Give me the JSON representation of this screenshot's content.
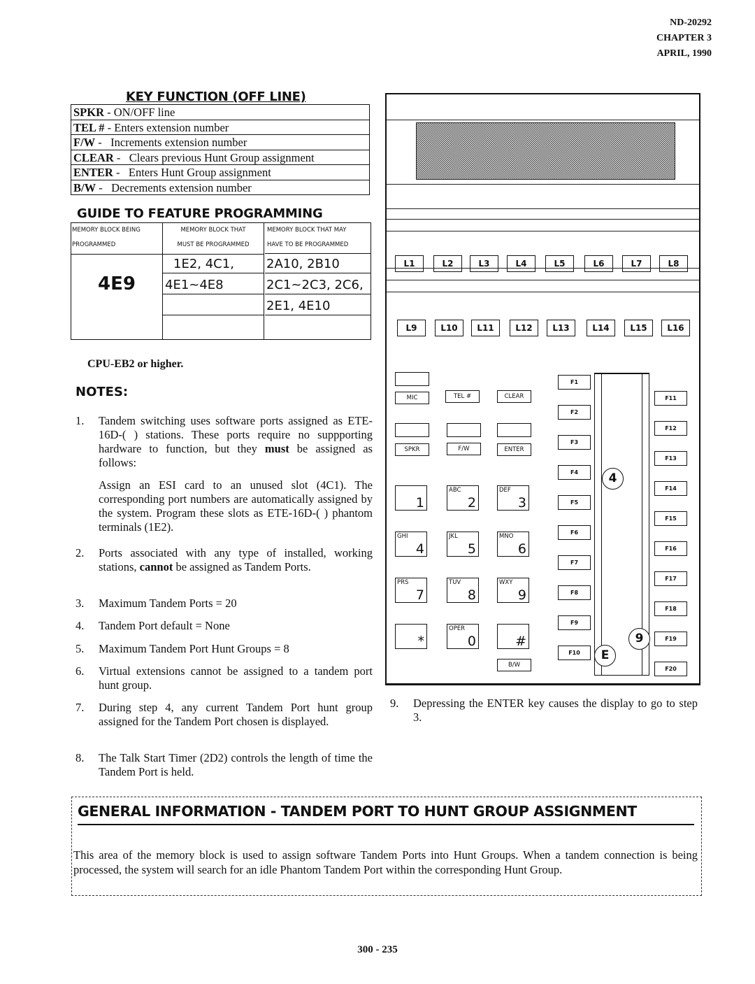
{
  "header": {
    "doc_id": "ND-20292",
    "chapter": "CHAPTER 3",
    "date": "APRIL, 1990"
  },
  "key_function": {
    "title": "KEY FUNCTION (OFF LINE)",
    "rows": [
      {
        "key": "SPKR",
        "sep": " - ",
        "desc": "ON/OFF line"
      },
      {
        "key": "TEL #",
        "sep": " - ",
        "desc": "Enters extension number"
      },
      {
        "key": "F/W",
        "sep": " -   ",
        "desc": "Increments extension number"
      },
      {
        "key": "CLEAR",
        "sep": " -   ",
        "desc": "Clears previous Hunt Group assignment"
      },
      {
        "key": "ENTER",
        "sep": " -   ",
        "desc": "Enters Hunt Group assignment"
      },
      {
        "key": "B/W",
        "sep": " -   ",
        "desc": "Decrements extension number"
      }
    ]
  },
  "guide": {
    "title": "GUIDE TO FEATURE PROGRAMMING",
    "headers": {
      "col1_l1": "MEMORY BLOCK BEING",
      "col1_l2": "PROGRAMMED",
      "col2_l1": "MEMORY BLOCK THAT",
      "col2_l2": "MUST BE PROGRAMMED",
      "col3_l1": "MEMORY BLOCK THAT MAY",
      "col3_l2": "HAVE TO BE PROGRAMMED"
    },
    "block": "4E9",
    "must": [
      "1E2, 4C1,",
      "4E1~4E8",
      "",
      ""
    ],
    "may": [
      "2A10, 2B10",
      "2C1~2C3, 2C6,",
      "2E1, 4E10",
      ""
    ]
  },
  "cpu_note": "CPU-EB2 or higher.",
  "notes_heading": "NOTES:",
  "notes": [
    {
      "num": "1.",
      "parts": [
        "Tandem switching uses software ports assigned as ETE-16D-(   ) stations. These ports require no suppporting hardware to function, but they ",
        "must",
        " be assigned as follows:"
      ]
    },
    {
      "num": "",
      "text": "Assign an ESI card to an unused slot (4C1). The corresponding port numbers are automatically assigned by the system. Program these slots as ETE-16D-(   ) phantom terminals (1E2)."
    },
    {
      "num": "2.",
      "parts": [
        "Ports associated with any type of installed, working stations, ",
        "cannot",
        " be assigned as Tandem Ports."
      ]
    },
    {
      "num": "3.",
      "text": "Maximum Tandem Ports = 20"
    },
    {
      "num": "4.",
      "text": "Tandem Port default = None"
    },
    {
      "num": "5.",
      "text": "Maximum Tandem Port Hunt Groups = 8"
    },
    {
      "num": "6.",
      "text": "Virtual extensions cannot be assigned to a tandem port hunt group."
    },
    {
      "num": "7.",
      "text": "During step 4, any current Tandem Port hunt group assigned for the Tandem Port chosen is displayed."
    },
    {
      "num": "8.",
      "text": "The Talk Start Timer (2D2) controls the length of time the Tandem Port is held."
    },
    {
      "num": "9.",
      "text": "Depressing the ENTER key causes the display to go to step 3."
    }
  ],
  "phone": {
    "line_keys_row1": [
      "L1",
      "L2",
      "L3",
      "L4",
      "L5",
      "L6",
      "L7",
      "L8"
    ],
    "line_keys_row2": [
      "L9",
      "L10",
      "L11",
      "L12",
      "L13",
      "L14",
      "L15",
      "L16"
    ],
    "function_keys": {
      "mic": "MIC",
      "tel": "TEL #",
      "clear": "CLEAR",
      "spkr": "SPKR",
      "fw": "F/W",
      "enter": "ENTER",
      "bw": "B/W"
    },
    "dialpad": [
      {
        "sub": "",
        "num": "1"
      },
      {
        "sub": "ABC",
        "num": "2"
      },
      {
        "sub": "DEF",
        "num": "3"
      },
      {
        "sub": "GHI",
        "num": "4"
      },
      {
        "sub": "JKL",
        "num": "5"
      },
      {
        "sub": "MNO",
        "num": "6"
      },
      {
        "sub": "PRS",
        "num": "7"
      },
      {
        "sub": "TUV",
        "num": "8"
      },
      {
        "sub": "WXY",
        "num": "9"
      },
      {
        "sub": "",
        "num": "*"
      },
      {
        "sub": "OPER",
        "num": "0"
      },
      {
        "sub": "",
        "num": "#"
      }
    ],
    "f_left": [
      "F1",
      "F2",
      "F3",
      "F4",
      "F5",
      "F6",
      "F7",
      "F8",
      "F9",
      "F10"
    ],
    "f_right": [
      "F11",
      "F12",
      "F13",
      "F14",
      "F15",
      "F16",
      "F17",
      "F18",
      "F19",
      "F20"
    ],
    "step_markers": {
      "step4": "4",
      "step9": "9",
      "stepE": "E"
    }
  },
  "general_info": {
    "title": "GENERAL INFORMATION - TANDEM PORT TO HUNT GROUP ASSIGNMENT",
    "body": "This area of the memory block is used to assign software Tandem Ports into Hunt Groups. When a tandem connection is being processed, the system will search for an idle Phantom Tandem Port within the corresponding Hunt Group."
  },
  "page_number": "300 - 235"
}
